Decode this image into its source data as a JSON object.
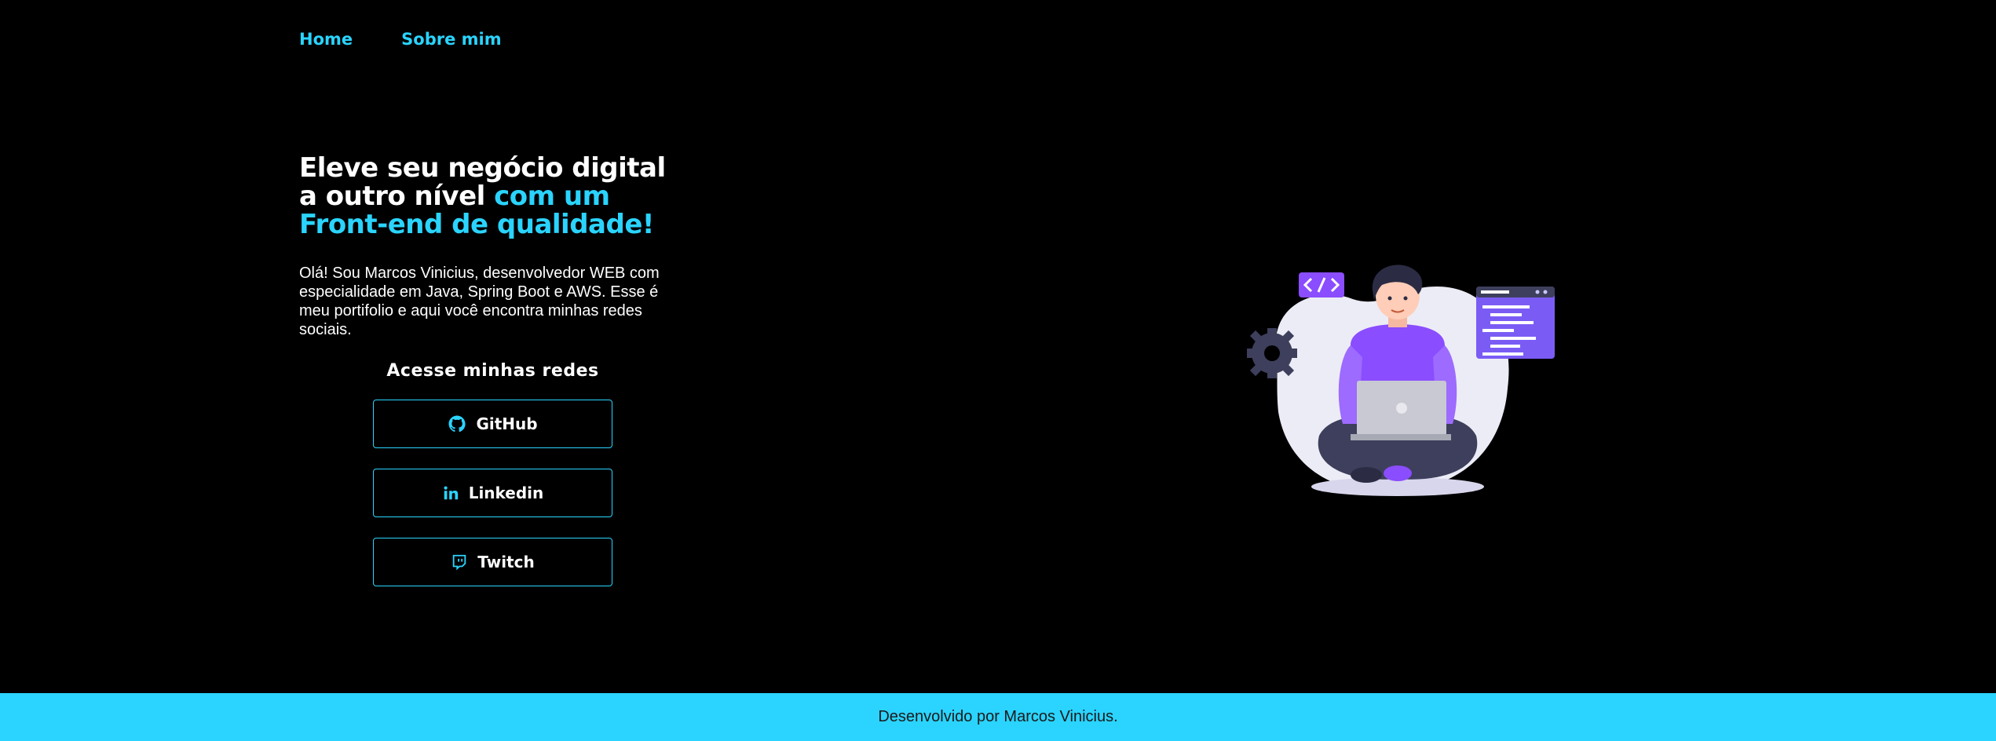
{
  "nav": {
    "items": [
      {
        "label": "Home"
      },
      {
        "label": "Sobre mim"
      }
    ]
  },
  "hero": {
    "headline_part1": "Eleve seu negócio digital",
    "headline_part2": "a outro nível ",
    "headline_accent1": "com um",
    "headline_accent2": "Front-end de qualidade!",
    "intro": "Olá! Sou Marcos Vinicius, desenvolvedor WEB com especialidade em Java, Spring Boot e AWS. Esse é meu portifolio e aqui você encontra minhas redes sociais."
  },
  "social": {
    "title": "Acesse minhas redes",
    "buttons": [
      {
        "label": "GitHub",
        "icon": "github-icon"
      },
      {
        "label": "Linkedin",
        "icon": "linkedin-icon"
      },
      {
        "label": "Twitch",
        "icon": "twitch-icon"
      }
    ]
  },
  "footer": {
    "text": "Desenvolvido por Marcos Vinicius."
  },
  "colors": {
    "accent": "#2ad4ff",
    "background": "#000000",
    "illustration_purple": "#8a4dff"
  }
}
